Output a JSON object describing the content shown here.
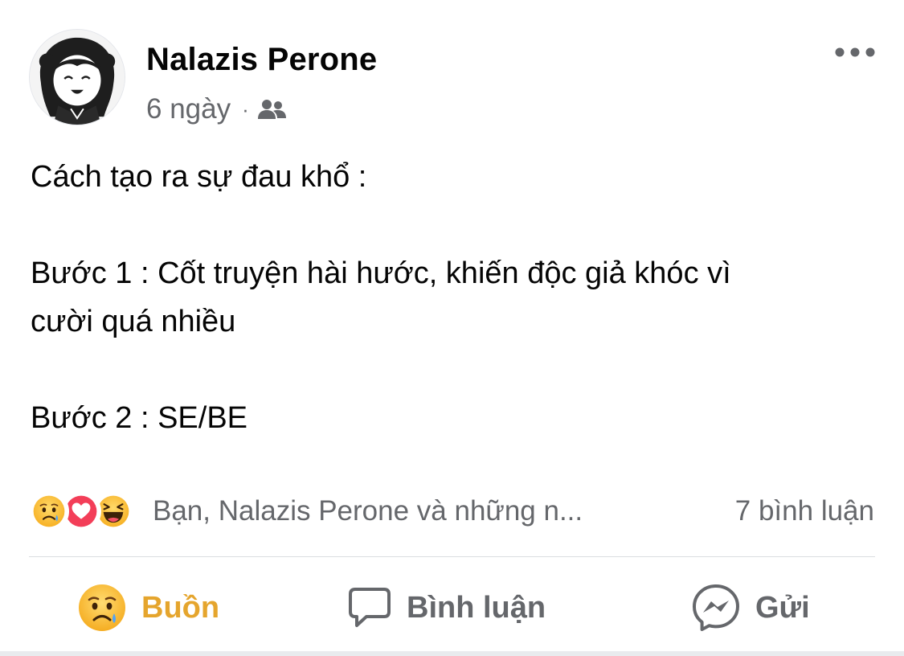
{
  "post": {
    "author": "Nalazis Perone",
    "time": "6 ngày",
    "separator": "·",
    "audience_icon": "friends-icon",
    "more_icon": "more-horizontal-icon",
    "lines": {
      "title": "Cách tạo ra sự đau khổ :",
      "step1_a": "Bước 1 : Cốt truyện hài hước, khiến độc giả khóc vì",
      "step1_b": "cười quá nhiều",
      "step2": "Bước 2 : SE/BE"
    }
  },
  "reactions": {
    "icons": [
      "sad-reaction-icon",
      "love-reaction-icon",
      "haha-reaction-icon"
    ],
    "summary": "Bạn, Nalazis Perone và những n...",
    "comments": "7 bình luận"
  },
  "actions": {
    "react_label": "Buồn",
    "comment_label": "Bình luận",
    "send_label": "Gửi"
  },
  "colors": {
    "sad_active": "#e5a52d",
    "secondary_text": "#65676b",
    "primary_text": "#050505",
    "love": "#f33e58"
  }
}
